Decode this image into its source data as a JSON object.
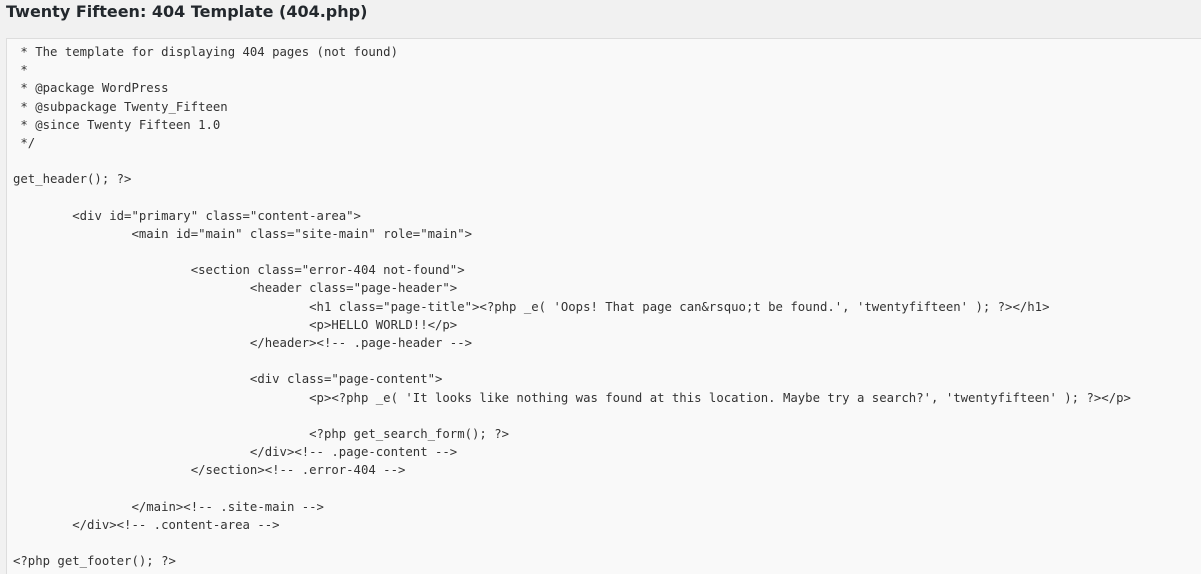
{
  "header": {
    "title": "Twenty Fifteen: 404 Template (404.php)"
  },
  "editor": {
    "lines": [
      " * The template for displaying 404 pages (not found)",
      " *",
      " * @package WordPress",
      " * @subpackage Twenty_Fifteen",
      " * @since Twenty Fifteen 1.0",
      " */",
      "",
      "get_header(); ?>",
      "",
      "\t<div id=\"primary\" class=\"content-area\">",
      "\t\t<main id=\"main\" class=\"site-main\" role=\"main\">",
      "",
      "\t\t\t<section class=\"error-404 not-found\">",
      "\t\t\t\t<header class=\"page-header\">",
      "\t\t\t\t\t<h1 class=\"page-title\"><?php _e( 'Oops! That page can&rsquo;t be found.', 'twentyfifteen' ); ?></h1>",
      "\t\t\t\t\t<p>HELLO WORLD!!</p>",
      "\t\t\t\t</header><!-- .page-header -->",
      "",
      "\t\t\t\t<div class=\"page-content\">",
      "\t\t\t\t\t<p><?php _e( 'It looks like nothing was found at this location. Maybe try a search?', 'twentyfifteen' ); ?></p>",
      "",
      "\t\t\t\t\t<?php get_search_form(); ?>",
      "\t\t\t\t</div><!-- .page-content -->",
      "\t\t\t</section><!-- .error-404 -->",
      "",
      "\t\t</main><!-- .site-main -->",
      "\t</div><!-- .content-area -->",
      "",
      "<?php get_footer(); ?>"
    ]
  }
}
